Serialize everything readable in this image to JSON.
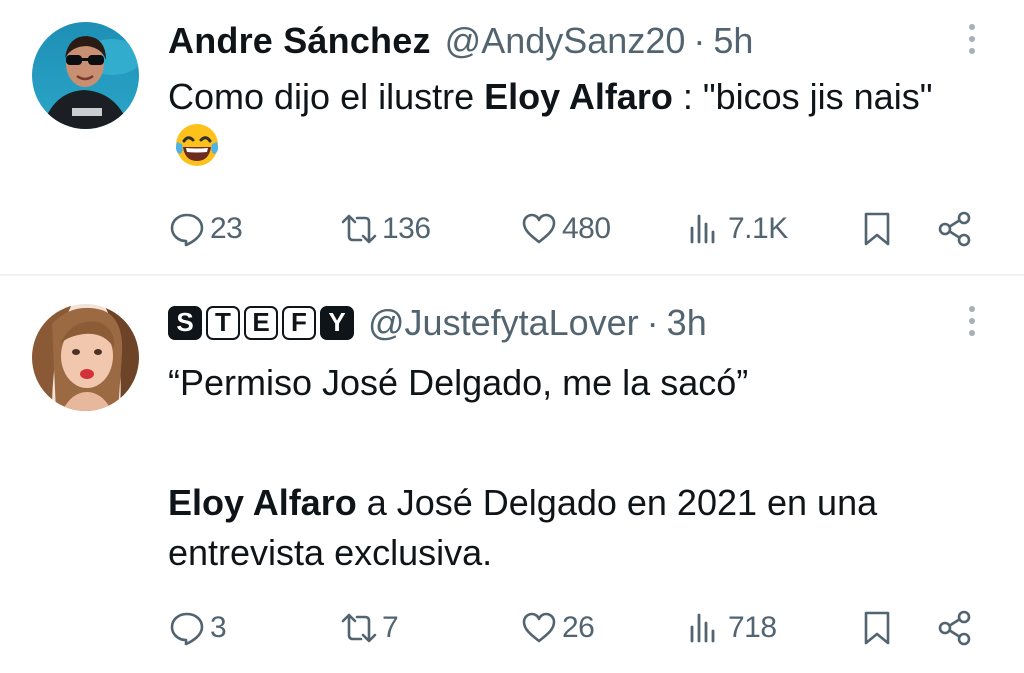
{
  "tweets": [
    {
      "display_name": "Andre Sánchez",
      "handle": "@AndySanz20",
      "separator": "·",
      "time": "5h",
      "text_before": "Como dijo el ilustre ",
      "text_bold": "Eloy Alfaro",
      "text_after": " : \"bicos jis nais\"",
      "emoji": "face-with-tears-of-joy",
      "stats": {
        "replies": "23",
        "retweets": "136",
        "likes": "480",
        "views": "7.1K"
      }
    },
    {
      "display_name_letters": [
        "S",
        "T",
        "E",
        "F",
        "Y"
      ],
      "handle": "@JustefytaLover",
      "separator": "·",
      "time": "3h",
      "line1": "“Permiso José Delgado, me la sacó”",
      "line2_bold": "Eloy Alfaro",
      "line2_rest": " a José Delgado en 2021 en una entrevista exclusiva.",
      "stats": {
        "replies": "3",
        "retweets": "7",
        "likes": "26",
        "views": "718"
      }
    }
  ],
  "icons": {
    "reply": "comment-icon",
    "retweet": "retweet-icon",
    "like": "heart-icon",
    "views": "views-icon",
    "bookmark": "bookmark-icon",
    "share": "share-icon",
    "more": "more-vertical-icon"
  },
  "colors": {
    "text_primary": "#0f1419",
    "text_secondary": "#536471",
    "divider": "#eff3f4"
  }
}
